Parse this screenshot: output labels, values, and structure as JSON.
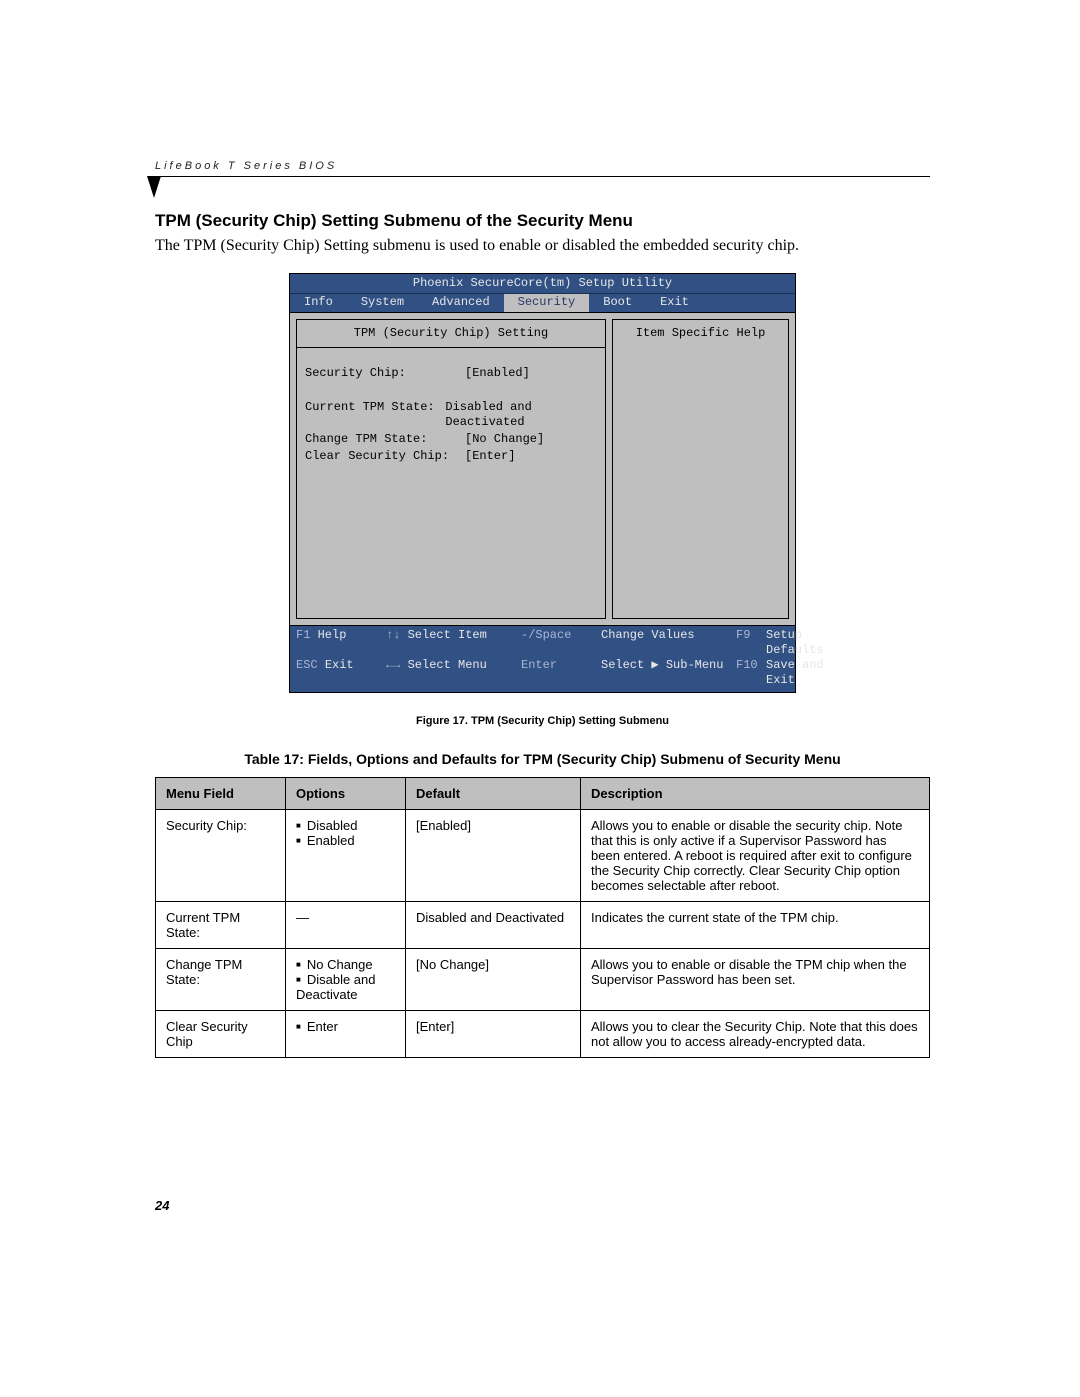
{
  "header": {
    "running_head": "LifeBook T Series BIOS"
  },
  "section": {
    "title": "TPM (Security Chip) Setting Submenu of the Security Menu",
    "intro": "The TPM (Security Chip) Setting submenu is used to enable or disabled the embedded security chip."
  },
  "bios": {
    "title": "Phoenix SecureCore(tm) Setup Utility",
    "tabs": [
      "Info",
      "System",
      "Advanced",
      "Security",
      "Boot",
      "Exit"
    ],
    "active_tab": "Security",
    "panel_title": "TPM (Security Chip) Setting",
    "help_title": "Item Specific Help",
    "rows": [
      {
        "label": "Security Chip:",
        "value": "[Enabled]"
      },
      {
        "label": "",
        "value": ""
      },
      {
        "label": "Current TPM State:",
        "value": "Disabled and Deactivated"
      },
      {
        "label": "Change TPM State:",
        "value": "[No Change]"
      },
      {
        "label": "Clear Security Chip:",
        "value": "[Enter]"
      }
    ],
    "footer": {
      "f1": "F1",
      "f1_label": "Help",
      "esc": "ESC",
      "esc_label": "Exit",
      "updown": "↑↓",
      "updown_label": "Select Item",
      "leftright": "←→",
      "leftright_label": "Select Menu",
      "minus": "-/Space",
      "minus_label": "Change Values",
      "enter": "Enter",
      "enter_label": "Select ▶ Sub-Menu",
      "f9": "F9",
      "f9_label": "Setup Defaults",
      "f10": "F10",
      "f10_label": "Save and Exit"
    }
  },
  "figure_caption": "Figure 17.  TPM (Security Chip) Setting Submenu",
  "table_caption": "Table 17: Fields, Options and Defaults for TPM (Security Chip) Submenu of Security Menu",
  "table": {
    "headers": [
      "Menu Field",
      "Options",
      "Default",
      "Description"
    ],
    "rows": [
      {
        "field": "Security Chip:",
        "options": [
          "Disabled",
          "Enabled"
        ],
        "default": "[Enabled]",
        "description": "Allows you to enable or disable the security chip. Note that this is only active if a Supervisor Password has been entered. A reboot is required after exit to configure the Security Chip correctly. Clear Security Chip option becomes selectable after reboot."
      },
      {
        "field": "Current TPM State:",
        "options_text": "—",
        "default": "Disabled and Deactivated",
        "description": "Indicates the current state of the TPM chip."
      },
      {
        "field": "Change TPM State:",
        "options": [
          "No Change",
          "Disable and Deactivate"
        ],
        "default": "[No Change]",
        "description": "Allows you to enable or disable the TPM chip when the Supervisor Password has been set."
      },
      {
        "field": "Clear Security Chip",
        "options": [
          "Enter"
        ],
        "default": "[Enter]",
        "description": "Allows you to clear the Security Chip. Note that this does not allow you to access already-encrypted data."
      }
    ]
  },
  "page_number": "24"
}
